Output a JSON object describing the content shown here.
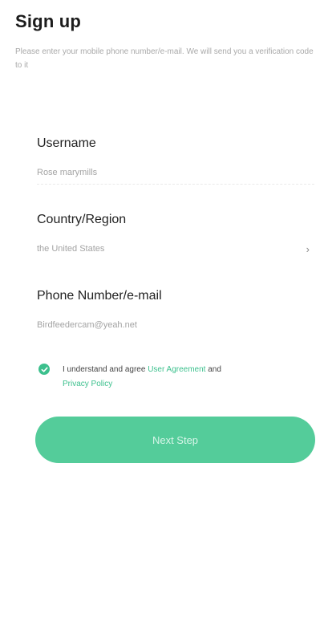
{
  "header": {
    "title": "Sign up",
    "description": "Please enter your mobile phone number/e-mail. We will send you a verification code to it"
  },
  "form": {
    "username": {
      "label": "Username",
      "value": "Rose marymills"
    },
    "country": {
      "label": "Country/Region",
      "value": "the United States"
    },
    "contact": {
      "label": "Phone Number/e-mail",
      "value": "Birdfeedercam@yeah.net"
    }
  },
  "agreement": {
    "checked": true,
    "text_prefix": "I understand and agree",
    "user_agreement_link": "User Agreement",
    "conjunction": "and",
    "privacy_link": "Privacy Policy"
  },
  "actions": {
    "next_label": "Next Step"
  },
  "colors": {
    "accent": "#3cc08d",
    "button": "#54cc9a"
  }
}
